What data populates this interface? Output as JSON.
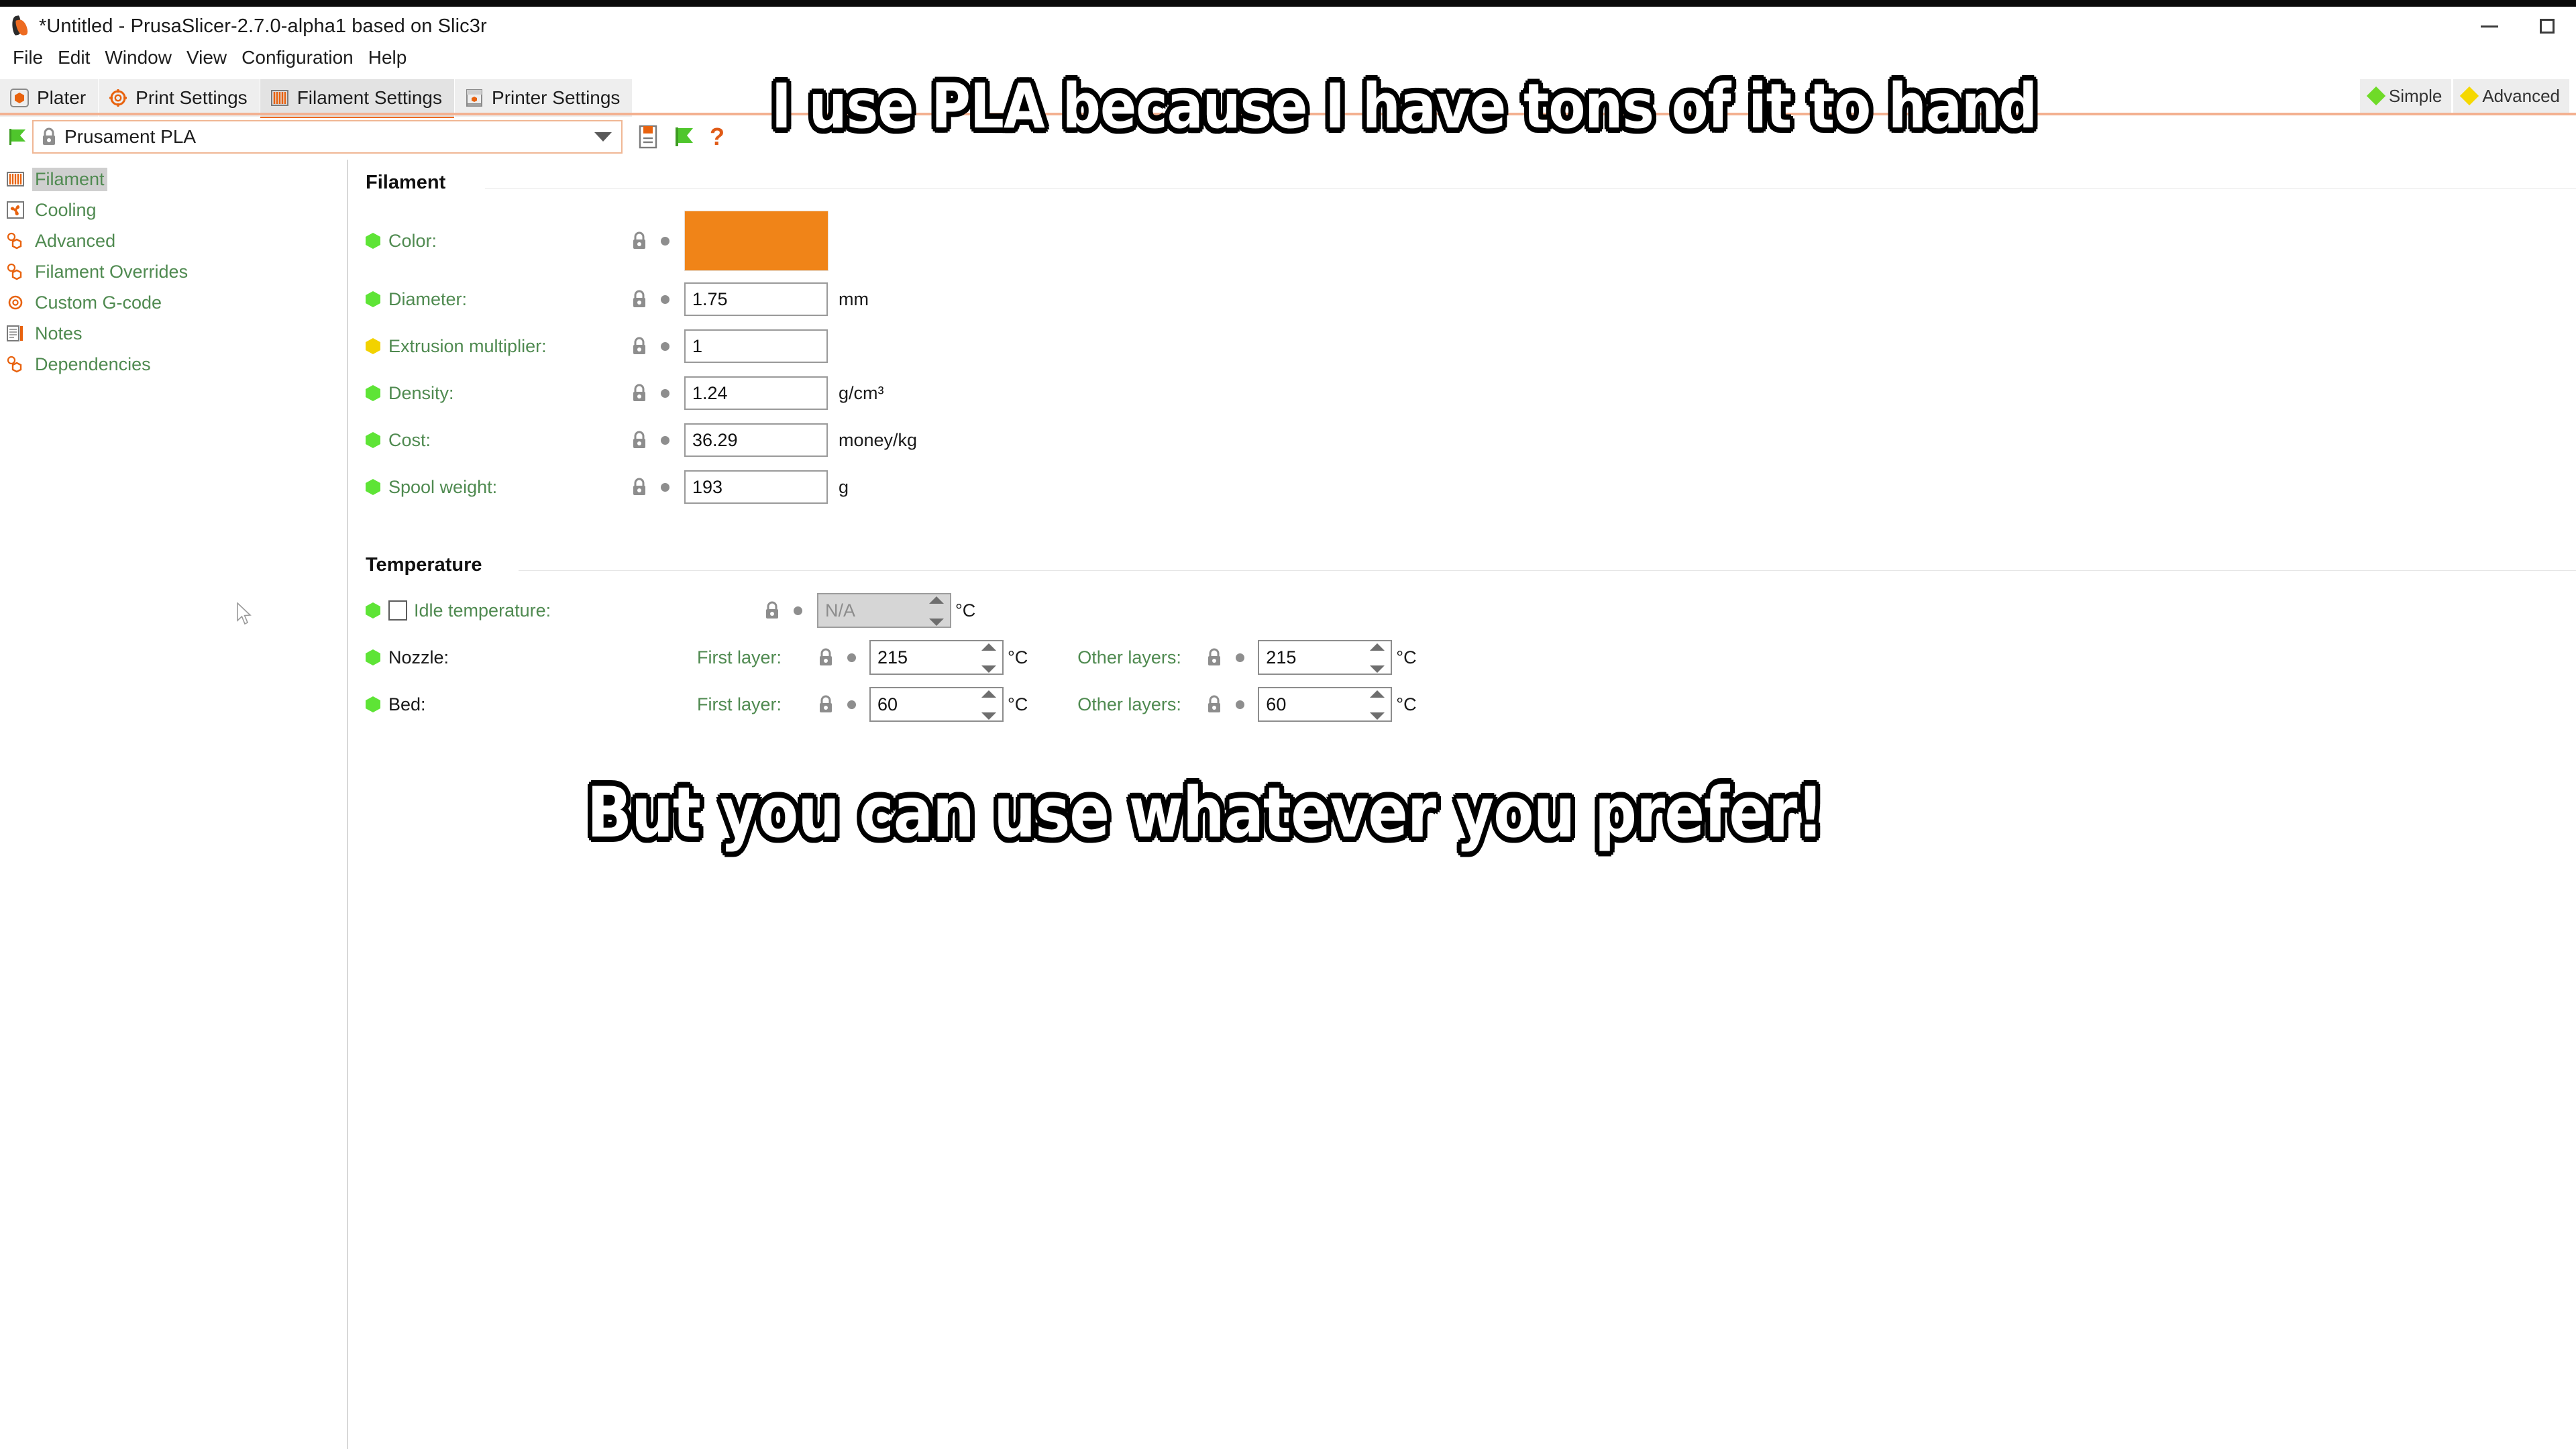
{
  "window": {
    "title": "*Untitled - PrusaSlicer-2.7.0-alpha1 based on Slic3r",
    "app_icon_name": "prusaslicer-logo",
    "minimize_label": "–",
    "maximize_label": "❐"
  },
  "menubar": {
    "items": [
      {
        "label": "File"
      },
      {
        "label": "Edit"
      },
      {
        "label": "Window"
      },
      {
        "label": "View"
      },
      {
        "label": "Configuration"
      },
      {
        "label": "Help"
      }
    ]
  },
  "tabs": [
    {
      "label": "Plater",
      "icon": "plater-icon",
      "active": false
    },
    {
      "label": "Print Settings",
      "icon": "print-settings-icon",
      "active": false
    },
    {
      "label": "Filament Settings",
      "icon": "filament-spool-icon",
      "active": true
    },
    {
      "label": "Printer Settings",
      "icon": "printer-icon",
      "active": false
    }
  ],
  "mode": {
    "simple_label": "Simple",
    "advanced_label": "Advanced",
    "simple_color": "#6fdb28",
    "advanced_color": "#f5d800"
  },
  "preset": {
    "name": "Prusament PLA",
    "flag_icon": "green-flag-icon",
    "lock_icon": "lock-closed-icon",
    "dropdown_icon": "chevron-down-icon",
    "save_icon": "save-preset-icon",
    "revert_icon": "green-flag-icon",
    "help_icon": "question-mark-icon",
    "help_label": "?"
  },
  "sidebar": {
    "items": [
      {
        "label": "Filament",
        "icon": "filament-spool-icon",
        "selected": true
      },
      {
        "label": "Cooling",
        "icon": "fan-icon",
        "selected": false
      },
      {
        "label": "Advanced",
        "icon": "cogs-icon",
        "selected": false
      },
      {
        "label": "Filament Overrides",
        "icon": "cogs-icon",
        "selected": false
      },
      {
        "label": "Custom G-code",
        "icon": "gear-icon",
        "selected": false
      },
      {
        "label": "Notes",
        "icon": "notes-icon",
        "selected": false
      },
      {
        "label": "Dependencies",
        "icon": "cogs-icon",
        "selected": false
      }
    ]
  },
  "filament_group": {
    "title": "Filament",
    "rows": [
      {
        "label": "Color:",
        "bullet": "green",
        "type": "color",
        "value": "#f08418",
        "unit": ""
      },
      {
        "label": "Diameter:",
        "bullet": "green",
        "type": "text",
        "value": "1.75",
        "unit": "mm"
      },
      {
        "label": "Extrusion multiplier:",
        "bullet": "yellow",
        "type": "text",
        "value": "1",
        "unit": ""
      },
      {
        "label": "Density:",
        "bullet": "green",
        "type": "text",
        "value": "1.24",
        "unit": "g/cm³"
      },
      {
        "label": "Cost:",
        "bullet": "green",
        "type": "text",
        "value": "36.29",
        "unit": "money/kg"
      },
      {
        "label": "Spool weight:",
        "bullet": "green",
        "type": "text",
        "value": "193",
        "unit": "g"
      }
    ]
  },
  "temperature_group": {
    "title": "Temperature",
    "idle": {
      "label": "Idle temperature:",
      "bullet": "green",
      "checked": false,
      "value": "N/A",
      "unit": "°C",
      "disabled": true
    },
    "rows": [
      {
        "label": "Nozzle:",
        "bullet": "green",
        "first_layer_label": "First layer:",
        "first_layer_value": "215",
        "other_layers_label": "Other layers:",
        "other_layers_value": "215",
        "unit": "°C"
      },
      {
        "label": "Bed:",
        "bullet": "green",
        "first_layer_label": "First layer:",
        "first_layer_value": "60",
        "other_layers_label": "Other layers:",
        "other_layers_value": "60",
        "unit": "°C"
      }
    ]
  },
  "captions": {
    "top": "I use PLA because I have tons of it to hand",
    "bottom": "But you can use whatever you prefer!"
  },
  "colors": {
    "accent_orange": "#ed6b21",
    "label_green": "#4f8a50",
    "bullet_green": "#5ee436",
    "bullet_yellow": "#f2d200",
    "filament_color": "#f08418"
  }
}
